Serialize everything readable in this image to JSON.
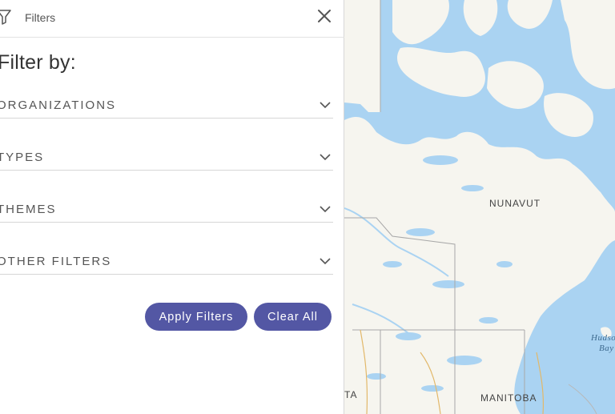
{
  "panel": {
    "title": "Filters",
    "heading": "Filter by:",
    "sections": [
      {
        "label": "ORGANIZATIONS"
      },
      {
        "label": "TYPES"
      },
      {
        "label": "THEMES"
      },
      {
        "label": "OTHER FILTERS"
      }
    ],
    "apply_label": "Apply Filters",
    "clear_label": "Clear All",
    "accent_color": "#5357a4"
  },
  "map": {
    "labels": {
      "nunavut": "NUNAVUT",
      "manitoba": "MANITOBA",
      "alberta_partial": "TA",
      "hudson_line1": "Hudso",
      "hudson_line2": "Bay"
    },
    "land_color": "#f6f5ef",
    "water_color": "#aad3f2"
  }
}
